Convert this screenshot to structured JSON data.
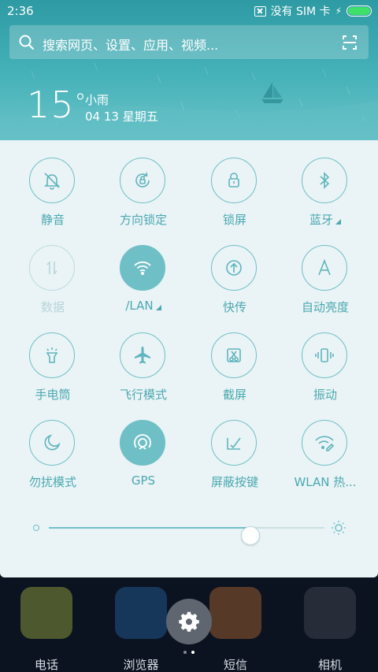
{
  "statusbar": {
    "time": "2:36",
    "sim_text": "没有 SIM 卡",
    "charging": "⚡",
    "battery_level": 1.0
  },
  "search": {
    "placeholder": "搜索网页、设置、应用、视频..."
  },
  "weather": {
    "temperature": "15",
    "degree": "°",
    "condition": "小雨",
    "date": "04 13 星期五"
  },
  "tiles": [
    {
      "label": "静音",
      "icon": "bell-mute-icon",
      "active": false
    },
    {
      "label": "方向锁定",
      "icon": "rotation-lock-icon",
      "active": false
    },
    {
      "label": "锁屏",
      "icon": "lock-icon",
      "active": false
    },
    {
      "label": "蓝牙",
      "icon": "bluetooth-icon",
      "active": false,
      "has_arrow": true
    },
    {
      "label": "数据",
      "icon": "data-arrows-icon",
      "active": false,
      "dim": true
    },
    {
      "label": "/LAN",
      "icon": "wifi-icon",
      "active": true,
      "has_arrow": true
    },
    {
      "label": "快传",
      "icon": "upload-icon",
      "active": false
    },
    {
      "label": "自动亮度",
      "icon": "auto-brightness-icon",
      "active": false
    },
    {
      "label": "手电筒",
      "icon": "flashlight-icon",
      "active": false
    },
    {
      "label": "飞行模式",
      "icon": "airplane-icon",
      "active": false
    },
    {
      "label": "截屏",
      "icon": "screenshot-icon",
      "active": false
    },
    {
      "label": "振动",
      "icon": "vibrate-icon",
      "active": false
    },
    {
      "label": "勿扰模式",
      "icon": "moon-icon",
      "active": false
    },
    {
      "label": "GPS",
      "icon": "gps-icon",
      "active": true
    },
    {
      "label": "屏蔽按键",
      "icon": "block-keys-icon",
      "active": false
    },
    {
      "label": "WLAN 热...",
      "icon": "wifi-hotspot-icon",
      "active": false
    }
  ],
  "brightness": {
    "level": 0.73
  },
  "dock": {
    "apps": [
      {
        "label": "电话",
        "color": "#c9d94a"
      },
      {
        "label": "浏览器",
        "color": "#2a78c9"
      },
      {
        "label": "短信",
        "color": "#e6823a"
      },
      {
        "label": "相机",
        "color": "#5b5f66"
      }
    ],
    "page_count": 2,
    "active_page": 1
  },
  "colors": {
    "accent": "#6fc0c6",
    "header": "#46b2b9",
    "panel_bg": "#eaf3f5"
  }
}
